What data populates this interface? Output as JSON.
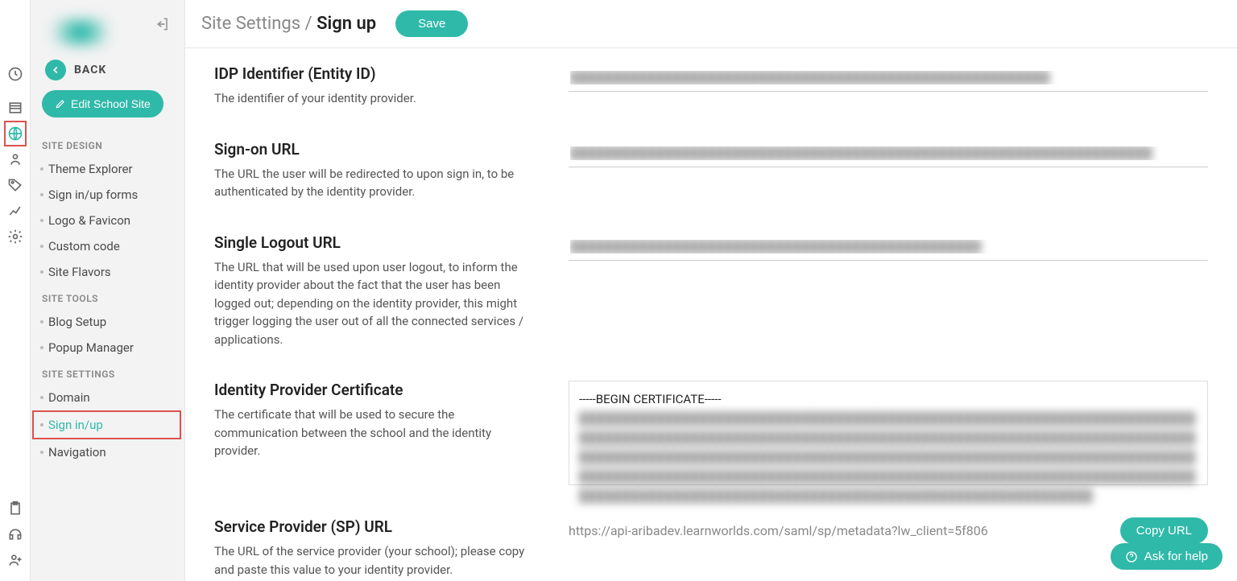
{
  "header": {
    "breadcrumb_parent": "Site Settings /",
    "breadcrumb_current": "Sign up",
    "save_label": "Save"
  },
  "sidebar": {
    "back_label": "BACK",
    "edit_button": "Edit School Site",
    "sections": {
      "site_design": {
        "title": "SITE DESIGN",
        "items": [
          "Theme Explorer",
          "Sign in/up forms",
          "Logo & Favicon",
          "Custom code",
          "Site Flavors"
        ]
      },
      "site_tools": {
        "title": "SITE TOOLS",
        "items": [
          "Blog Setup",
          "Popup Manager"
        ]
      },
      "site_settings": {
        "title": "SITE SETTINGS",
        "items": [
          "Domain",
          "Sign in/up",
          "Navigation"
        ]
      }
    }
  },
  "fields": {
    "idp": {
      "title": "IDP Identifier (Entity ID)",
      "desc": "The identifier of your identity provider.",
      "value": "████████████████████████████████████████████████████████"
    },
    "signon": {
      "title": "Sign-on URL",
      "desc": "The URL the user will be redirected to upon sign in, to be authenticated by the identity provider.",
      "value": "████████████████████████████████████████████████████████████████████"
    },
    "slo": {
      "title": "Single Logout URL",
      "desc": "The URL that will be used upon user logout, to inform the identity provider about the fact that the user has been logged out; depending on the identity provider, this might trigger logging the user out of all the connected services / applications.",
      "value": "████████████████████████████████████████████████"
    },
    "cert": {
      "title": "Identity Provider Certificate",
      "desc": "The certificate that will be used to secure the communication between the school and the identity provider.",
      "first_line": "-----BEGIN CERTIFICATE-----",
      "blurred": "████████████████████████████████████████████████████████████████████████████████████████████████████████████████████████████████████████████████████████████████████████████████████████████████████████████████████████████████████████████████████████████████████████████████████████████████████████████████████████████████████████████████████████████"
    },
    "sp": {
      "title": "Service Provider (SP) URL",
      "desc": "The URL of the service provider (your school); please copy and paste this value to your identity provider.",
      "url": "https://api-aribadev.learnworlds.com/saml/sp/metadata?lw_client=5f806",
      "copy_label": "Copy URL"
    }
  },
  "ask_help": "Ask for help"
}
